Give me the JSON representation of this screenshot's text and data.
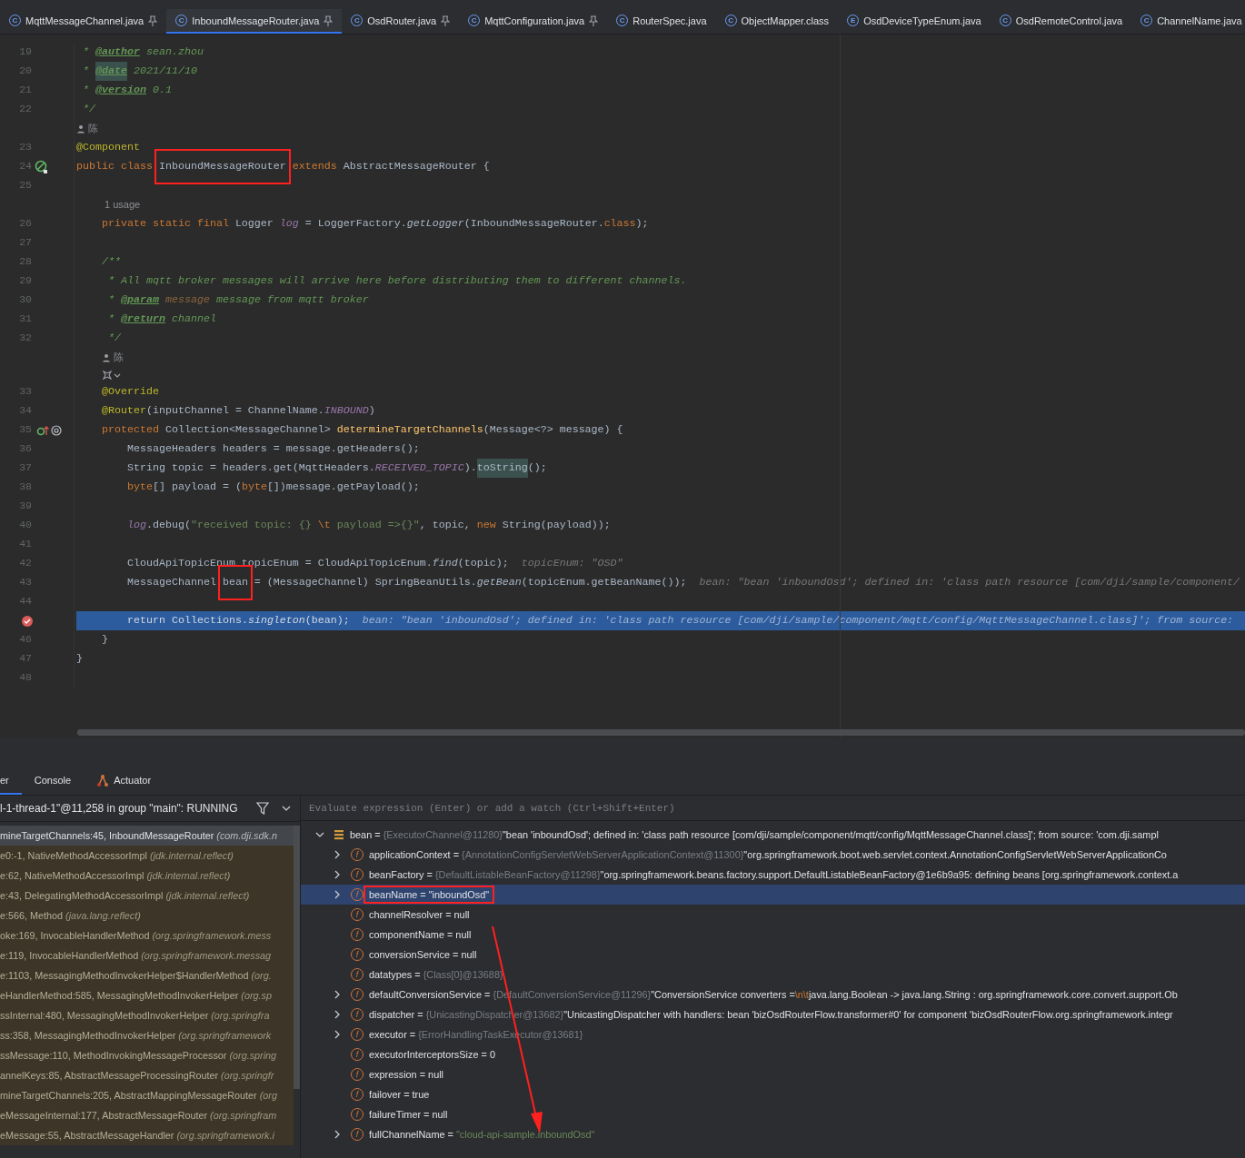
{
  "tabs": [
    {
      "label": "MqttMessageChannel.java",
      "badge": "C",
      "pinned": true,
      "selected": false
    },
    {
      "label": "InboundMessageRouter.java",
      "badge": "C",
      "pinned": true,
      "selected": true
    },
    {
      "label": "OsdRouter.java",
      "badge": "C",
      "pinned": true,
      "selected": false
    },
    {
      "label": "MqttConfiguration.java",
      "badge": "C",
      "pinned": true,
      "selected": false
    },
    {
      "label": "RouterSpec.java",
      "badge": "C",
      "pinned": false,
      "selected": false
    },
    {
      "label": "ObjectMapper.class",
      "badge": "C",
      "pinned": false,
      "selected": false
    },
    {
      "label": "OsdDeviceTypeEnum.java",
      "badge": "E",
      "pinned": false,
      "selected": false
    },
    {
      "label": "OsdRemoteControl.java",
      "badge": "C",
      "pinned": false,
      "selected": false
    },
    {
      "label": "ChannelName.java",
      "badge": "C",
      "pinned": false,
      "selected": false
    }
  ],
  "code_lines": [
    {
      "kind": "code",
      "num": "19",
      "tokens": [
        {
          "text": " * ",
          "kind": "doc"
        },
        {
          "text": "@author",
          "kind": "doctag"
        },
        {
          "text": " sean.zhou",
          "kind": "doc"
        }
      ]
    },
    {
      "kind": "code",
      "num": "20",
      "tokens": [
        {
          "text": " * ",
          "kind": "doc"
        },
        {
          "text": "@date",
          "kind": "doctag-hl"
        },
        {
          "text": " 2021/11/10",
          "kind": "doc"
        }
      ]
    },
    {
      "kind": "code",
      "num": "21",
      "tokens": [
        {
          "text": " * ",
          "kind": "doc"
        },
        {
          "text": "@version",
          "kind": "doctag"
        },
        {
          "text": " 0.1",
          "kind": "doc"
        }
      ]
    },
    {
      "kind": "code",
      "num": "22",
      "tokens": [
        {
          "text": " */",
          "kind": "doc"
        }
      ]
    },
    {
      "kind": "author",
      "text": "陈"
    },
    {
      "kind": "code",
      "num": "23",
      "tokens": [
        {
          "text": "@Component",
          "kind": "ann"
        }
      ]
    },
    {
      "kind": "code",
      "num": "24",
      "gutter": {
        "kind": "bean"
      },
      "tokens": [
        {
          "text": "public class ",
          "kind": "kw"
        },
        {
          "text": "InboundMessageRouter",
          "kind": "boxed"
        },
        {
          "text": " extends ",
          "kind": "kw"
        },
        {
          "text": "AbstractMessageRouter {",
          "kind": "plain"
        }
      ]
    },
    {
      "kind": "code",
      "num": "25"
    },
    {
      "kind": "usage",
      "text": "1 usage"
    },
    {
      "kind": "code",
      "num": "26",
      "tokens": [
        {
          "text": "    private static final ",
          "kind": "kw"
        },
        {
          "text": "Logger ",
          "kind": "plain"
        },
        {
          "text": "log",
          "kind": "field"
        },
        {
          "text": " = LoggerFactory.",
          "kind": "plain"
        },
        {
          "text": "getLogger",
          "kind": "static"
        },
        {
          "text": "(InboundMessageRouter.",
          "kind": "plain"
        },
        {
          "text": "class",
          "kind": "kw"
        },
        {
          "text": ");",
          "kind": "plain"
        }
      ]
    },
    {
      "kind": "code",
      "num": "27"
    },
    {
      "kind": "code",
      "num": "28",
      "tokens": [
        {
          "text": "    /**",
          "kind": "doc"
        }
      ]
    },
    {
      "kind": "code",
      "num": "29",
      "tokens": [
        {
          "text": "     * All mqtt broker messages will arrive here before distributing them to different channels.",
          "kind": "doc"
        }
      ]
    },
    {
      "kind": "code",
      "num": "30",
      "tokens": [
        {
          "text": "     * ",
          "kind": "doc"
        },
        {
          "text": "@param",
          "kind": "doctag"
        },
        {
          "text": " message",
          "kind": "docparam"
        },
        {
          "text": " message from mqtt broker",
          "kind": "doc"
        }
      ]
    },
    {
      "kind": "code",
      "num": "31",
      "tokens": [
        {
          "text": "     * ",
          "kind": "doc"
        },
        {
          "text": "@return",
          "kind": "doctag"
        },
        {
          "text": " channel",
          "kind": "doc"
        }
      ]
    },
    {
      "kind": "code",
      "num": "32",
      "tokens": [
        {
          "text": "     */",
          "kind": "doc"
        }
      ]
    },
    {
      "kind": "author",
      "text": "陈"
    },
    {
      "kind": "ai"
    },
    {
      "kind": "code",
      "num": "33",
      "tokens": [
        {
          "text": "    @Override",
          "kind": "ann"
        }
      ]
    },
    {
      "kind": "code",
      "num": "34",
      "tokens": [
        {
          "text": "    @Router",
          "kind": "ann"
        },
        {
          "text": "(inputChannel = ChannelName.",
          "kind": "plain"
        },
        {
          "text": "INBOUND",
          "kind": "field"
        },
        {
          "text": ")",
          "kind": "plain"
        }
      ]
    },
    {
      "kind": "code",
      "num": "35",
      "gutter": {
        "kind": "override"
      },
      "tokens": [
        {
          "text": "    protected ",
          "kind": "kw"
        },
        {
          "text": "Collection<MessageChannel> ",
          "kind": "plain"
        },
        {
          "text": "determineTargetChannels",
          "kind": "method"
        },
        {
          "text": "(Message<?> message) {",
          "kind": "plain"
        }
      ]
    },
    {
      "kind": "code",
      "num": "36",
      "tokens": [
        {
          "text": "        MessageHeaders headers = message.getHeaders();",
          "kind": "plain"
        }
      ]
    },
    {
      "kind": "code",
      "num": "37",
      "tokens": [
        {
          "text": "        String topic = headers.get(MqttHeaders.",
          "kind": "plain"
        },
        {
          "text": "RECEIVED_TOPIC",
          "kind": "field"
        },
        {
          "text": ").",
          "kind": "plain"
        },
        {
          "text": "toString",
          "kind": "plain-hl"
        },
        {
          "text": "();",
          "kind": "plain"
        }
      ]
    },
    {
      "kind": "code",
      "num": "38",
      "tokens": [
        {
          "text": "        byte",
          "kind": "kw"
        },
        {
          "text": "[] payload = (",
          "kind": "plain"
        },
        {
          "text": "byte",
          "kind": "kw"
        },
        {
          "text": "[])message.getPayload();",
          "kind": "plain"
        }
      ]
    },
    {
      "kind": "code",
      "num": "39"
    },
    {
      "kind": "code",
      "num": "40",
      "tokens": [
        {
          "text": "        log",
          "kind": "field"
        },
        {
          "text": ".debug(",
          "kind": "plain"
        },
        {
          "text": "\"received topic: {} ",
          "kind": "string"
        },
        {
          "text": "\\t",
          "kind": "escape"
        },
        {
          "text": " payload =>{}\"",
          "kind": "string"
        },
        {
          "text": ", topic, ",
          "kind": "plain"
        },
        {
          "text": "new ",
          "kind": "kw"
        },
        {
          "text": "String(payload));",
          "kind": "plain"
        }
      ]
    },
    {
      "kind": "code",
      "num": "41"
    },
    {
      "kind": "code",
      "num": "42",
      "tokens": [
        {
          "text": "        CloudApiTopicEnum topicEnum = CloudApiTopicEnum.",
          "kind": "plain"
        },
        {
          "text": "find",
          "kind": "static"
        },
        {
          "text": "(topic);",
          "kind": "plain"
        },
        {
          "text": "  topicEnum: \"OSD\"",
          "kind": "hint"
        }
      ]
    },
    {
      "kind": "code",
      "num": "43",
      "tokens": [
        {
          "text": "        MessageChannel ",
          "kind": "plain"
        },
        {
          "text": "bean",
          "kind": "boxed"
        },
        {
          "text": " = (MessageChannel) SpringBeanUtils.",
          "kind": "plain"
        },
        {
          "text": "getBean",
          "kind": "static"
        },
        {
          "text": "(topicEnum.getBeanName());",
          "kind": "plain"
        },
        {
          "text": "  bean: \"bean 'inboundOsd'; defined in: 'class path resource [com/dji/sample/component/",
          "kind": "hint"
        }
      ]
    },
    {
      "kind": "code",
      "num": "44"
    },
    {
      "kind": "exec",
      "gutter": {
        "kind": "breakpoint"
      },
      "tokens": [
        {
          "text": "        return ",
          "kind": "kw"
        },
        {
          "text": "Collections.",
          "kind": "plain"
        },
        {
          "text": "singleton",
          "kind": "static"
        },
        {
          "text": "(bean);",
          "kind": "plain"
        },
        {
          "text": "  bean: \"bean 'inboundOsd'; defined in: 'class path resource [com/dji/sample/component/mqtt/config/MqttMessageChannel.class]'; from source:",
          "kind": "hint"
        }
      ]
    },
    {
      "kind": "code",
      "num": "46",
      "tokens": [
        {
          "text": "    }",
          "kind": "plain"
        }
      ]
    },
    {
      "kind": "code",
      "num": "47",
      "tokens": [
        {
          "text": "}",
          "kind": "plain"
        }
      ]
    },
    {
      "kind": "code",
      "num": "48"
    }
  ],
  "tool_tabs": [
    {
      "label": "er",
      "kind": "plain",
      "selected": true
    },
    {
      "label": "Console",
      "kind": "plain",
      "selected": false
    },
    {
      "label": "Actuator",
      "kind": "actuator",
      "selected": false
    }
  ],
  "thread": "l-1-thread-1\"@11,258 in group \"main\": RUNNING",
  "frames": [
    {
      "text": "mineTargetChannels:45, InboundMessageRouter",
      "pkg": "(com.dji.sdk.n",
      "selected": true
    },
    {
      "text": "e0:-1, NativeMethodAccessorImpl",
      "pkg": "(jdk.internal.reflect)",
      "selected": false
    },
    {
      "text": "e:62, NativeMethodAccessorImpl",
      "pkg": "(jdk.internal.reflect)",
      "selected": false
    },
    {
      "text": "e:43, DelegatingMethodAccessorImpl",
      "pkg": "(jdk.internal.reflect)",
      "selected": false
    },
    {
      "text": "e:566, Method",
      "pkg": "(java.lang.reflect)",
      "selected": false
    },
    {
      "text": "oke:169, InvocableHandlerMethod",
      "pkg": "(org.springframework.mess",
      "selected": false
    },
    {
      "text": "e:119, InvocableHandlerMethod",
      "pkg": "(org.springframework.messag",
      "selected": false
    },
    {
      "text": "e:1103, MessagingMethodInvokerHelper$HandlerMethod",
      "pkg": "(org.",
      "selected": false
    },
    {
      "text": "eHandlerMethod:585, MessagingMethodInvokerHelper",
      "pkg": "(org.sp",
      "selected": false
    },
    {
      "text": "ssInternal:480, MessagingMethodInvokerHelper",
      "pkg": "(org.springfra",
      "selected": false
    },
    {
      "text": "ss:358, MessagingMethodInvokerHelper",
      "pkg": "(org.springframework",
      "selected": false
    },
    {
      "text": "ssMessage:110, MethodInvokingMessageProcessor",
      "pkg": "(org.spring",
      "selected": false
    },
    {
      "text": "annelKeys:85, AbstractMessageProcessingRouter",
      "pkg": "(org.springfr",
      "selected": false
    },
    {
      "text": "mineTargetChannels:205, AbstractMappingMessageRouter",
      "pkg": "(org",
      "selected": false
    },
    {
      "text": "eMessageInternal:177, AbstractMessageRouter",
      "pkg": "(org.springfram",
      "selected": false
    },
    {
      "text": "eMessage:55, AbstractMessageHandler",
      "pkg": "(org.springframework.i",
      "selected": false
    }
  ],
  "evaluate": {
    "placeholder": "Evaluate expression (Enter) or add a watch (Ctrl+Shift+Enter)"
  },
  "variables": [
    {
      "name": "bean =",
      "kind": "object",
      "expanded": true,
      "selected": false,
      "type": "{ExecutorChannel@11280}",
      "value": [
        {
          "text": "\"bean 'inboundOsd'; defined in: 'class path resource [com/dji/sample/component/mqtt/config/MqttMessageChannel.class]'; from source: 'com.dji.sampl",
          "kind": "plain"
        }
      ],
      "children": [
        {
          "name": "applicationContext =",
          "kind": "field",
          "badge": "f",
          "expanded": false,
          "selected": false,
          "type": "{AnnotationConfigServletWebServerApplicationContext@11300}",
          "value": [
            {
              "text": "\"org.springframework.boot.web.servlet.context.AnnotationConfigServletWebServerApplicationCo",
              "kind": "plain"
            }
          ]
        },
        {
          "name": "beanFactory =",
          "kind": "field",
          "badge": "f",
          "expanded": false,
          "selected": false,
          "type": "{DefaultListableBeanFactory@11298}",
          "value": [
            {
              "text": "\"org.springframework.beans.factory.support.DefaultListableBeanFactory@1e6b9a95: defining beans [org.springframework.context.a",
              "kind": "plain"
            }
          ]
        },
        {
          "name": "beanName =",
          "kind": "field",
          "badge": "f",
          "expanded": false,
          "selected": true,
          "boxed": true,
          "value": [
            {
              "text": "\"inboundOsd\"",
              "kind": "string"
            }
          ]
        },
        {
          "name": "channelResolver =",
          "kind": "field",
          "badge": "f",
          "selected": false,
          "value": [
            {
              "text": "null",
              "kind": "plain"
            }
          ]
        },
        {
          "name": "componentName =",
          "kind": "field",
          "badge": "f",
          "selected": false,
          "value": [
            {
              "text": "null",
              "kind": "plain"
            }
          ]
        },
        {
          "name": "conversionService =",
          "kind": "field",
          "badge": "f",
          "selected": false,
          "value": [
            {
              "text": "null",
              "kind": "plain"
            }
          ]
        },
        {
          "name": "datatypes =",
          "kind": "field",
          "badge": "f",
          "selected": false,
          "type": "{Class[0]@13688}"
        },
        {
          "name": "defaultConversionService =",
          "kind": "field",
          "badge": "f",
          "expanded": false,
          "selected": false,
          "type": "{DefaultConversionService@11296}",
          "value": [
            {
              "text": "\"ConversionService converters =",
              "kind": "plain"
            },
            {
              "text": "\\n\\t",
              "kind": "escape"
            },
            {
              "text": "java.lang.Boolean -> java.lang.String : org.springframework.core.convert.support.Ob",
              "kind": "plain"
            }
          ]
        },
        {
          "name": "dispatcher =",
          "kind": "field",
          "badge": "f",
          "expanded": false,
          "selected": false,
          "type": "{UnicastingDispatcher@13682}",
          "value": [
            {
              "text": "\"UnicastingDispatcher with handlers: bean 'bizOsdRouterFlow.transformer#0' for component 'bizOsdRouterFlow.org.springframework.integr",
              "kind": "plain"
            }
          ]
        },
        {
          "name": "executor =",
          "kind": "field",
          "badge": "f",
          "expanded": false,
          "selected": false,
          "type": "{ErrorHandlingTaskExecutor@13681}"
        },
        {
          "name": "executorInterceptorsSize =",
          "kind": "field",
          "badge": "f",
          "selected": false,
          "value": [
            {
              "text": "0",
              "kind": "plain"
            }
          ]
        },
        {
          "name": "expression =",
          "kind": "field",
          "badge": "f",
          "selected": false,
          "value": [
            {
              "text": "null",
              "kind": "plain"
            }
          ]
        },
        {
          "name": "failover =",
          "kind": "field",
          "badge": "f",
          "selected": false,
          "value": [
            {
              "text": "true",
              "kind": "plain"
            }
          ]
        },
        {
          "name": "failureTimer =",
          "kind": "field",
          "badge": "f",
          "selected": false,
          "value": [
            {
              "text": "null",
              "kind": "plain"
            }
          ]
        },
        {
          "name": "fullChannelName =",
          "kind": "field",
          "badge": "f",
          "expanded": false,
          "selected": false,
          "value": [
            {
              "text": "\"cloud-api-sample.inboundOsd\"",
              "kind": "string"
            }
          ]
        }
      ]
    }
  ]
}
